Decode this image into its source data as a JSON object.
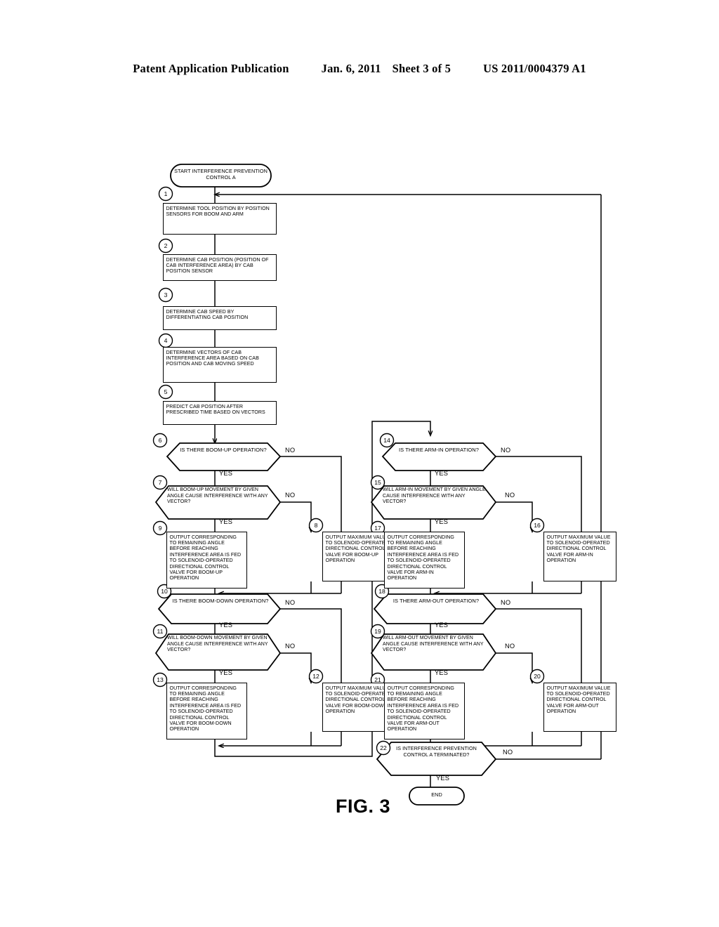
{
  "header": {
    "publication": "Patent Application Publication",
    "date": "Jan. 6, 2011",
    "sheet": "Sheet 3 of 5",
    "number": "US 2011/0004379 A1"
  },
  "figure": {
    "label": "FIG. 3"
  },
  "chart_data": {
    "type": "diagram",
    "title": "FIG. 3",
    "diagram_kind": "flowchart",
    "node_count": 25,
    "nodes": [
      {
        "id": "start",
        "shape": "terminator",
        "step": "",
        "text": "START INTERFERENCE PREVENTION CONTROL A"
      },
      {
        "id": "s1",
        "shape": "process",
        "step": "1",
        "text": "DETERMINE TOOL POSITION BY POSITION SENSORS FOR BOOM AND ARM"
      },
      {
        "id": "s2",
        "shape": "process",
        "step": "2",
        "text": "DETERMINE CAB POSITION (POSITION OF CAB INTERFERENCE AREA) BY CAB POSITION SENSOR"
      },
      {
        "id": "s3",
        "shape": "process",
        "step": "3",
        "text": "DETERMINE CAB SPEED BY DIFFERENTIATING CAB POSITION"
      },
      {
        "id": "s4",
        "shape": "process",
        "step": "4",
        "text": "DETERMINE VECTORS OF CAB INTERFERENCE AREA BASED ON CAB POSITION AND CAB MOVING SPEED"
      },
      {
        "id": "s5",
        "shape": "process",
        "step": "5",
        "text": "PREDICT CAB POSITION AFTER PRESCRIBED TIME BASED ON VECTORS"
      },
      {
        "id": "s6",
        "shape": "decision",
        "step": "6",
        "text": "IS THERE BOOM-UP OPERATION?"
      },
      {
        "id": "s7",
        "shape": "decision",
        "step": "7",
        "text": "WILL BOOM-UP MOVEMENT BY GIVEN ANGLE CAUSE INTERFERENCE WITH ANY VECTOR?"
      },
      {
        "id": "s8",
        "shape": "process",
        "step": "8",
        "text": "OUTPUT MAXIMUM VALUE TO SOLENOID-OPERATED DIRECTIONAL CONTROL VALVE FOR BOOM-UP OPERATION"
      },
      {
        "id": "s9",
        "shape": "process",
        "step": "9",
        "text": "OUTPUT CORRESPONDING TO REMAINING ANGLE BEFORE REACHING INTERFERENCE AREA IS FED TO SOLENOID-OPERATED DIRECTIONAL CONTROL VALVE FOR BOOM-UP OPERATION"
      },
      {
        "id": "s10",
        "shape": "decision",
        "step": "10",
        "text": "IS THERE BOOM-DOWN OPERATION?"
      },
      {
        "id": "s11",
        "shape": "decision",
        "step": "11",
        "text": "WILL BOOM-DOWN MOVEMENT BY GIVEN ANGLE CAUSE INTERFERENCE WITH ANY VECTOR?"
      },
      {
        "id": "s12",
        "shape": "process",
        "step": "12",
        "text": "OUTPUT MAXIMUM VALUE TO SOLENOID-OPERATED DIRECTIONAL CONTROL VALVE FOR BOOM-DOWN OPERATION"
      },
      {
        "id": "s13",
        "shape": "process",
        "step": "13",
        "text": "OUTPUT CORRESPONDING TO REMAINING ANGLE BEFORE REACHING INTERFERENCE AREA IS FED TO SOLENOID-OPERATED DIRECTIONAL CONTROL VALVE FOR BOOM-DOWN OPERATION"
      },
      {
        "id": "s14",
        "shape": "decision",
        "step": "14",
        "text": "IS THERE ARM-IN OPERATION?"
      },
      {
        "id": "s15",
        "shape": "decision",
        "step": "15",
        "text": "WILL ARM-IN MOVEMENT BY GIVEN ANGLE CAUSE INTERFERENCE WITH ANY VECTOR?"
      },
      {
        "id": "s16",
        "shape": "process",
        "step": "16",
        "text": "OUTPUT MAXIMUM VALUE TO SOLENOID-OPERATED DIRECTIONAL CONTROL VALVE FOR ARM-IN OPERATION"
      },
      {
        "id": "s17",
        "shape": "process",
        "step": "17",
        "text": "OUTPUT CORRESPONDING TO REMAINING ANGLE BEFORE REACHING INTERFERENCE AREA IS FED TO SOLENOID-OPERATED DIRECTIONAL CONTROL VALVE FOR ARM-IN OPERATION"
      },
      {
        "id": "s18",
        "shape": "decision",
        "step": "18",
        "text": "IS THERE ARM-OUT OPERATION?"
      },
      {
        "id": "s19",
        "shape": "decision",
        "step": "19",
        "text": "WILL ARM-OUT MOVEMENT BY GIVEN ANGLE CAUSE INTERFERENCE WITH ANY VECTOR?"
      },
      {
        "id": "s20",
        "shape": "process",
        "step": "20",
        "text": "OUTPUT MAXIMUM VALUE TO SOLENOID-OPERATED DIRECTIONAL CONTROL VALVE FOR ARM-OUT OPERATION"
      },
      {
        "id": "s21",
        "shape": "process",
        "step": "21",
        "text": "OUTPUT CORRESPONDING TO REMAINING ANGLE BEFORE REACHING INTERFERENCE AREA IS FED TO SOLENOID-OPERATED DIRECTIONAL CONTROL VALVE FOR ARM-OUT OPERATION"
      },
      {
        "id": "s22",
        "shape": "decision",
        "step": "22",
        "text": "IS INTERFERENCE PREVENTION CONTROL A TERMINATED?"
      },
      {
        "id": "end",
        "shape": "terminator",
        "step": "",
        "text": "END"
      }
    ],
    "edge_labels": {
      "yes": "YES",
      "no": "NO"
    },
    "edges": [
      {
        "from": "start",
        "to": "s1",
        "label": ""
      },
      {
        "from": "s1",
        "to": "s2",
        "label": ""
      },
      {
        "from": "s2",
        "to": "s3",
        "label": ""
      },
      {
        "from": "s3",
        "to": "s4",
        "label": ""
      },
      {
        "from": "s4",
        "to": "s5",
        "label": ""
      },
      {
        "from": "s5",
        "to": "s6",
        "label": ""
      },
      {
        "from": "s6",
        "to": "s7",
        "label": "YES"
      },
      {
        "from": "s6",
        "to": "s10",
        "label": "NO"
      },
      {
        "from": "s7",
        "to": "s9",
        "label": "YES"
      },
      {
        "from": "s7",
        "to": "s8",
        "label": "NO"
      },
      {
        "from": "s8",
        "to": "s10",
        "label": ""
      },
      {
        "from": "s9",
        "to": "s10",
        "label": ""
      },
      {
        "from": "s10",
        "to": "s11",
        "label": "YES"
      },
      {
        "from": "s10",
        "to": "s14",
        "label": "NO"
      },
      {
        "from": "s11",
        "to": "s13",
        "label": "YES"
      },
      {
        "from": "s11",
        "to": "s12",
        "label": "NO"
      },
      {
        "from": "s12",
        "to": "s14",
        "label": ""
      },
      {
        "from": "s13",
        "to": "s14",
        "label": ""
      },
      {
        "from": "s14",
        "to": "s15",
        "label": "YES"
      },
      {
        "from": "s14",
        "to": "s18",
        "label": "NO"
      },
      {
        "from": "s15",
        "to": "s17",
        "label": "YES"
      },
      {
        "from": "s15",
        "to": "s16",
        "label": "NO"
      },
      {
        "from": "s16",
        "to": "s18",
        "label": ""
      },
      {
        "from": "s17",
        "to": "s18",
        "label": ""
      },
      {
        "from": "s18",
        "to": "s19",
        "label": "YES"
      },
      {
        "from": "s18",
        "to": "s22",
        "label": "NO"
      },
      {
        "from": "s19",
        "to": "s21",
        "label": "YES"
      },
      {
        "from": "s19",
        "to": "s20",
        "label": "NO"
      },
      {
        "from": "s20",
        "to": "s22",
        "label": ""
      },
      {
        "from": "s21",
        "to": "s22",
        "label": ""
      },
      {
        "from": "s22",
        "to": "end",
        "label": "YES"
      },
      {
        "from": "s22",
        "to": "s1",
        "label": "NO"
      }
    ]
  }
}
